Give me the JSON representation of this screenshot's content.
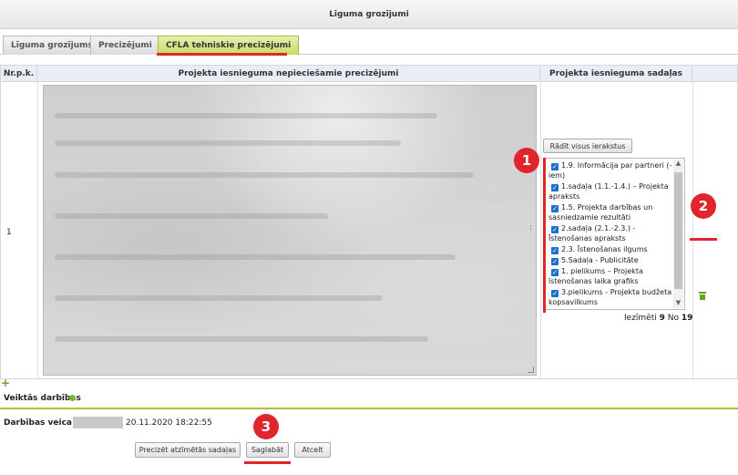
{
  "window": {
    "title": "Līguma grozījumi"
  },
  "tabs": [
    {
      "label": "Līguma grozījums",
      "active": false
    },
    {
      "label": "Precizējumi",
      "active": false
    },
    {
      "label": "CFLA tehniskie precizējumi",
      "active": true
    }
  ],
  "table": {
    "headers": [
      "Nr.p.k.",
      "Projekta iesnieguma nepieciešamie precizējumi",
      "Projekta iesnieguma sadaļas"
    ],
    "row": {
      "number": "1"
    }
  },
  "sections": {
    "show_all_label": "Rādīt visus ierakstus",
    "items": [
      {
        "label": "1.9. Informācija par partneri (-iem)",
        "checked": true
      },
      {
        "label": "1.sadaļa (1.1.-1.4.) – Projekta apraksts",
        "checked": true
      },
      {
        "label": "1.5. Projekta darbības un sasniedzamie rezultāti",
        "checked": true
      },
      {
        "label": "2.sadaļa (2.1.-2.3.) - Īstenošanas apraksts",
        "checked": true
      },
      {
        "label": "2.3. Īstenošanas ilgums",
        "checked": true
      },
      {
        "label": "5.Sadaļa - Publicitāte",
        "checked": true
      },
      {
        "label": "1. pielikums – Projekta īstenošanas laika grafiks",
        "checked": true
      },
      {
        "label": "3.pielikums - Projekta budžeta kopsavilkums",
        "checked": true
      }
    ],
    "count_prefix": "Iezīmēti",
    "count_selected": "9",
    "count_middle": "No",
    "count_total": "19"
  },
  "markers": [
    "1",
    "2",
    "3"
  ],
  "actions": {
    "section_label": "Veiktās darbības",
    "performed_by_label": "Darbības veica",
    "datetime": "20.11.2020 18:22:55"
  },
  "buttons": {
    "refine": "Precizēt atzīmētās sadaļas",
    "save": "Saglabāt",
    "cancel": "Atcelt"
  },
  "colors": {
    "accent_red": "#e0262c",
    "tab_active": "#c8dc62",
    "green": "#6aa326",
    "checkbox": "#1f6fd1"
  },
  "icons": [
    "trash-icon",
    "plus-icon",
    "status-dot-icon",
    "checkbox-icon"
  ]
}
